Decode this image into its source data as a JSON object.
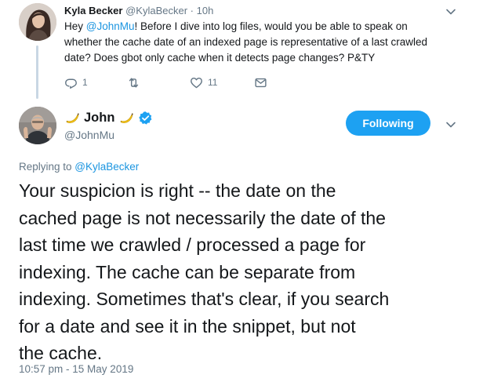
{
  "reply_tweet": {
    "author_name": "Kyla Becker",
    "author_handle": "@KylaBecker",
    "separator": "·",
    "time": "10h",
    "text_before_mention": "Hey ",
    "mention": "@JohnMu",
    "text_line1_after": "! Before I dive into log files, would you be able to speak on",
    "text_line2": "whether the cache date of an indexed page is representative of a last crawled",
    "text_line3": "date? Does gbot only cache when it detects page changes? P&TY",
    "actions": {
      "reply_count": "1",
      "retweet_count": "",
      "like_count": "11"
    }
  },
  "main_tweet": {
    "author_name": "John",
    "author_handle": "@JohnMu",
    "follow_button_label": "Following",
    "replying_prefix": "Replying to ",
    "replying_to": "@KylaBecker",
    "text_lines": [
      "Your suspicion is right -- the date on the",
      "cached page is not necessarily the date of the",
      "last time we crawled / processed a page for",
      "indexing. The cache can be separate from",
      "indexing. Sometimes that's clear, if you search",
      "for a date and see it in the snippet, but not",
      "the cache."
    ],
    "timestamp": "10:57 pm - 15 May 2019"
  },
  "icons": {
    "reply": "reply-icon",
    "retweet": "retweet-icon",
    "like": "heart-icon",
    "dm": "envelope-icon",
    "more": "chevron-down-icon",
    "verified": "verified-badge-icon",
    "banana": "banana-emoji-icon"
  },
  "colors": {
    "accent": "#1da1f2",
    "link": "#1b95e0",
    "muted": "#657786",
    "text": "#14171a",
    "thread_line": "#c9d7e4"
  }
}
